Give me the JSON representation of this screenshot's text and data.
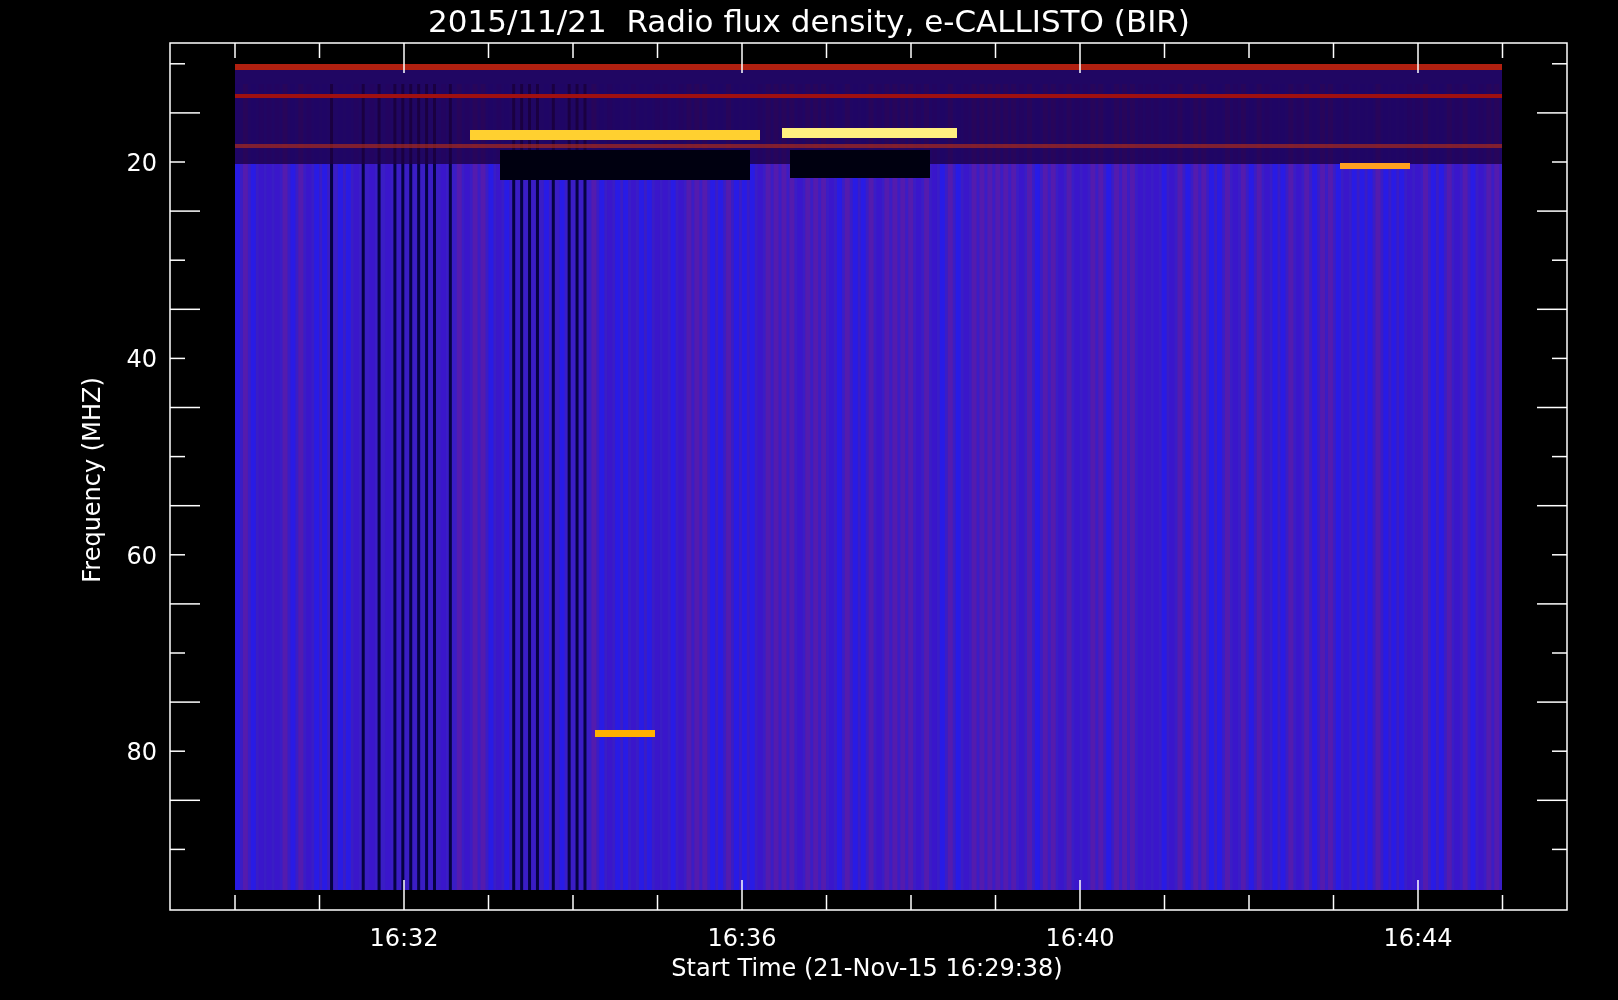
{
  "title": "2015/11/21  Radio flux density, e-CALLISTO (BIR)",
  "y_axis": {
    "label": "Frequency (MHZ)",
    "ticks": [
      "20",
      "40",
      "60",
      "80"
    ]
  },
  "x_axis": {
    "label": "Start Time (21-Nov-15 16:29:38)",
    "ticks": [
      "16:32",
      "16:36",
      "16:40",
      "16:44"
    ]
  }
}
